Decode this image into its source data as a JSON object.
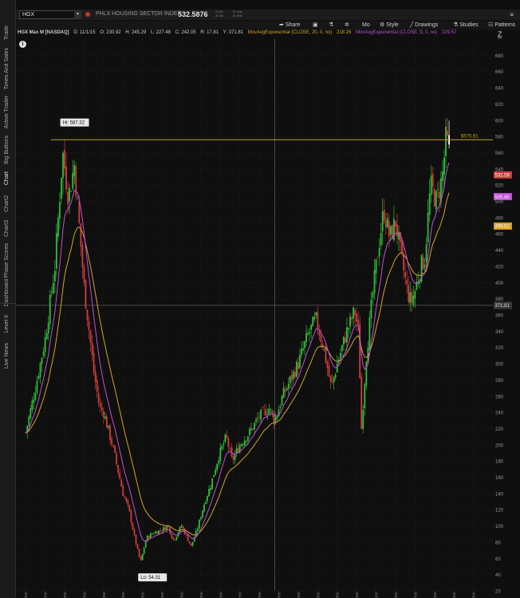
{
  "sidebar": {
    "tabs": [
      {
        "label": "Trade"
      },
      {
        "label": "Times And Sales"
      },
      {
        "label": "Active Trader"
      },
      {
        "label": "Big Buttons"
      },
      {
        "label": "Chart"
      },
      {
        "label": "Chart2"
      },
      {
        "label": "Chart3"
      },
      {
        "label": "Phase Scores"
      },
      {
        "label": "Dashboard"
      },
      {
        "label": "Level II"
      },
      {
        "label": "Live News"
      }
    ],
    "active_tab": "Chart"
  },
  "symbol_bar": {
    "symbol": "HGX",
    "index_name": "PHLX HOUSING SECTOR INDEX",
    "last_price": "532.5876",
    "vol_line1": "-2.0%",
    "vol_line2": "-10.52",
    "bid_line": "B: N/A",
    "ask_line": "A: N/A",
    "menu_icon": "hamburger-icon"
  },
  "toolbar": {
    "share": "Share",
    "mo": "Mo",
    "style": "Style",
    "drawings": "Drawings",
    "studies": "Studies",
    "patterns": "Patterns"
  },
  "chart_header": {
    "title": "HGX Max M [NASDAQ]",
    "date": "D: 11/1/15",
    "open": "O: 230.92",
    "high": "H: 245.29",
    "low": "L: 227.48",
    "close": "C: 242.05",
    "range": "R: 17.81",
    "y": "Y: 371.81",
    "ema20_label": "MovAvgExponential (CLOSE, 20, 0, no)",
    "ema20_value": "218.26",
    "ema9_label": "MovAvgExponential (CLOSE, 9, 0, no)",
    "ema9_value": "229.57"
  },
  "colors": {
    "background": "#0f0f0f",
    "grid": "#2a2a2a",
    "candle_up": "#2fbf3a",
    "candle_down": "#d23c3c",
    "last_candle": "#ffffff",
    "ema20": "#d4a32a",
    "ema9": "#c24fd8",
    "hline": "#c9a227"
  },
  "chart_data": {
    "type": "candlestick",
    "interval": "monthly",
    "ylim": [
      20,
      700
    ],
    "y_ticks": [
      20,
      40,
      60,
      80,
      100,
      120,
      140,
      160,
      180,
      200,
      220,
      240,
      260,
      280,
      300,
      320,
      340,
      360,
      380,
      400,
      420,
      440,
      460,
      480,
      500,
      520,
      540,
      560,
      580,
      600,
      620,
      640,
      660,
      680
    ],
    "x_tick_labels": [
      "2003 year",
      "2004 year",
      "2005 year",
      "2006 year",
      "2007 year",
      "2008 year",
      "2009 year",
      "2010 year",
      "2011 year",
      "2012 year",
      "2013 year",
      "2014 year",
      "2015 year",
      "2016 year",
      "2017 year",
      "2018 year",
      "2019 year",
      "2020 year",
      "2021 year",
      "2022 year",
      "2023 year",
      "2024 year",
      "2025 year",
      "2026 year"
    ],
    "close_series": [
      [
        2003.0,
        215
      ],
      [
        2003.5,
        270
      ],
      [
        2004.0,
        330
      ],
      [
        2004.5,
        420
      ],
      [
        2004.9,
        560
      ],
      [
        2005.2,
        505
      ],
      [
        2005.5,
        545
      ],
      [
        2005.75,
        470
      ],
      [
        2006.0,
        395
      ],
      [
        2006.5,
        290
      ],
      [
        2006.8,
        245
      ],
      [
        2007.0,
        240
      ],
      [
        2007.5,
        195
      ],
      [
        2008.0,
        140
      ],
      [
        2008.3,
        120
      ],
      [
        2008.6,
        85
      ],
      [
        2008.9,
        55
      ],
      [
        2009.2,
        85
      ],
      [
        2009.6,
        92
      ],
      [
        2010.0,
        95
      ],
      [
        2010.3,
        100
      ],
      [
        2010.6,
        82
      ],
      [
        2011.0,
        100
      ],
      [
        2011.5,
        75
      ],
      [
        2011.8,
        95
      ],
      [
        2012.2,
        130
      ],
      [
        2012.5,
        150
      ],
      [
        2012.9,
        185
      ],
      [
        2013.3,
        210
      ],
      [
        2013.6,
        180
      ],
      [
        2014.0,
        200
      ],
      [
        2014.5,
        215
      ],
      [
        2015.0,
        235
      ],
      [
        2015.5,
        245
      ],
      [
        2015.8,
        230
      ],
      [
        2016.2,
        260
      ],
      [
        2016.6,
        280
      ],
      [
        2017.0,
        300
      ],
      [
        2017.5,
        335
      ],
      [
        2017.9,
        355
      ],
      [
        2018.3,
        320
      ],
      [
        2018.7,
        270
      ],
      [
        2019.0,
        300
      ],
      [
        2019.5,
        340
      ],
      [
        2019.9,
        365
      ],
      [
        2020.1,
        340
      ],
      [
        2020.25,
        220
      ],
      [
        2020.5,
        310
      ],
      [
        2020.8,
        380
      ],
      [
        2021.1,
        440
      ],
      [
        2021.4,
        490
      ],
      [
        2021.7,
        455
      ],
      [
        2022.0,
        475
      ],
      [
        2022.3,
        430
      ],
      [
        2022.6,
        390
      ],
      [
        2022.8,
        375
      ],
      [
        2023.0,
        390
      ],
      [
        2023.3,
        420
      ],
      [
        2023.5,
        430
      ],
      [
        2023.8,
        520
      ],
      [
        2024.1,
        500
      ],
      [
        2024.4,
        530
      ],
      [
        2024.6,
        580
      ],
      [
        2024.75,
        560
      ],
      [
        2024.83,
        532.59
      ]
    ],
    "high_label": "Hi: 587.32",
    "low_label": "Lo: 54.31",
    "hline": {
      "value": 575.91,
      "label": "$575.91"
    },
    "crosshair": {
      "value": 371.81,
      "label": "371.81"
    },
    "price_tags": [
      {
        "value": 532.59,
        "label": "532.59",
        "color": "#d23c3c"
      },
      {
        "value": 505.85,
        "label": "505.85",
        "color": "#c24fd8"
      },
      {
        "value": 469.52,
        "label": "469.52",
        "color": "#d4a32a"
      }
    ]
  }
}
